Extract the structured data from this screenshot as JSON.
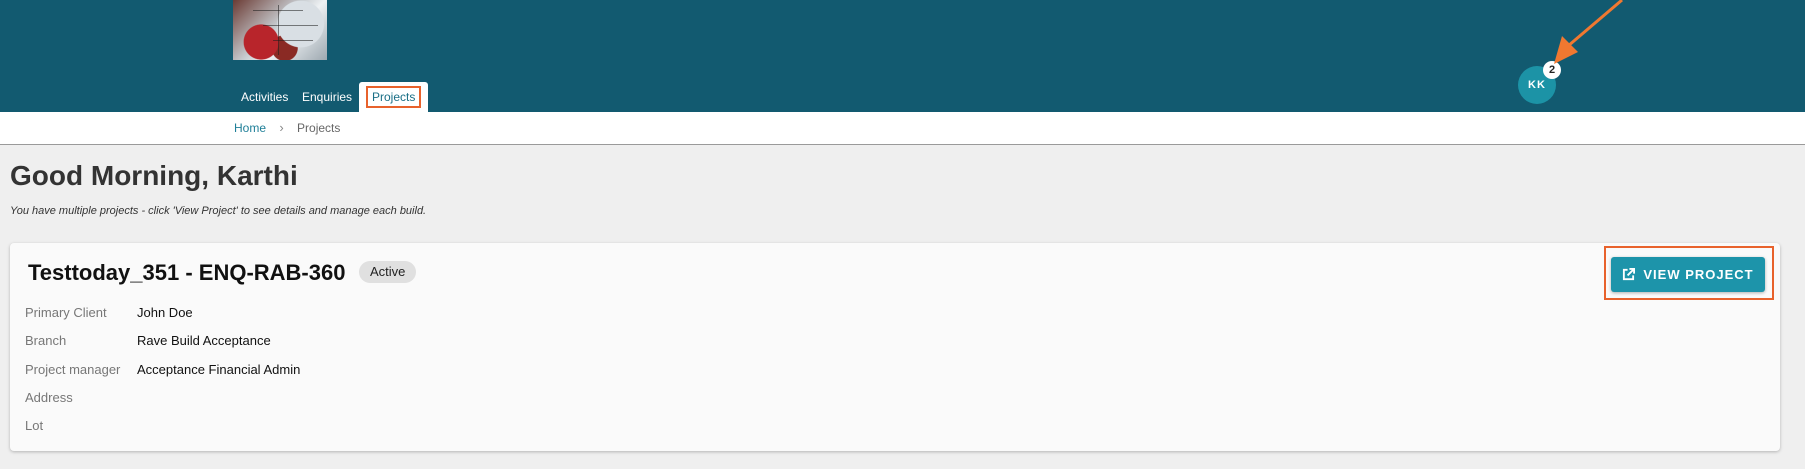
{
  "header": {
    "nav": [
      "Activities",
      "Enquiries",
      "Projects"
    ],
    "active_nav": "Projects",
    "avatar_initials": "KK",
    "notification_count": "2"
  },
  "breadcrumb": {
    "home": "Home",
    "separator": "›",
    "current": "Projects"
  },
  "greeting": "Good Morning, Karthi",
  "subtitle": "You have multiple projects - click 'View Project' to see details and manage each build.",
  "project": {
    "title": "Testtoday_351 - ENQ-RAB-360",
    "status": "Active",
    "fields": [
      {
        "label": "Primary Client",
        "value": "John Doe"
      },
      {
        "label": "Branch",
        "value": "Rave Build Acceptance"
      },
      {
        "label": "Project manager",
        "value": "Acceptance Financial Admin"
      },
      {
        "label": "Address",
        "value": ""
      },
      {
        "label": "Lot",
        "value": ""
      }
    ],
    "view_button": "VIEW PROJECT"
  },
  "icons": {
    "external_link": "open-in-new-icon"
  },
  "colors": {
    "header_bg": "#125a70",
    "accent": "#1d94aa",
    "highlight": "#e8622c"
  }
}
